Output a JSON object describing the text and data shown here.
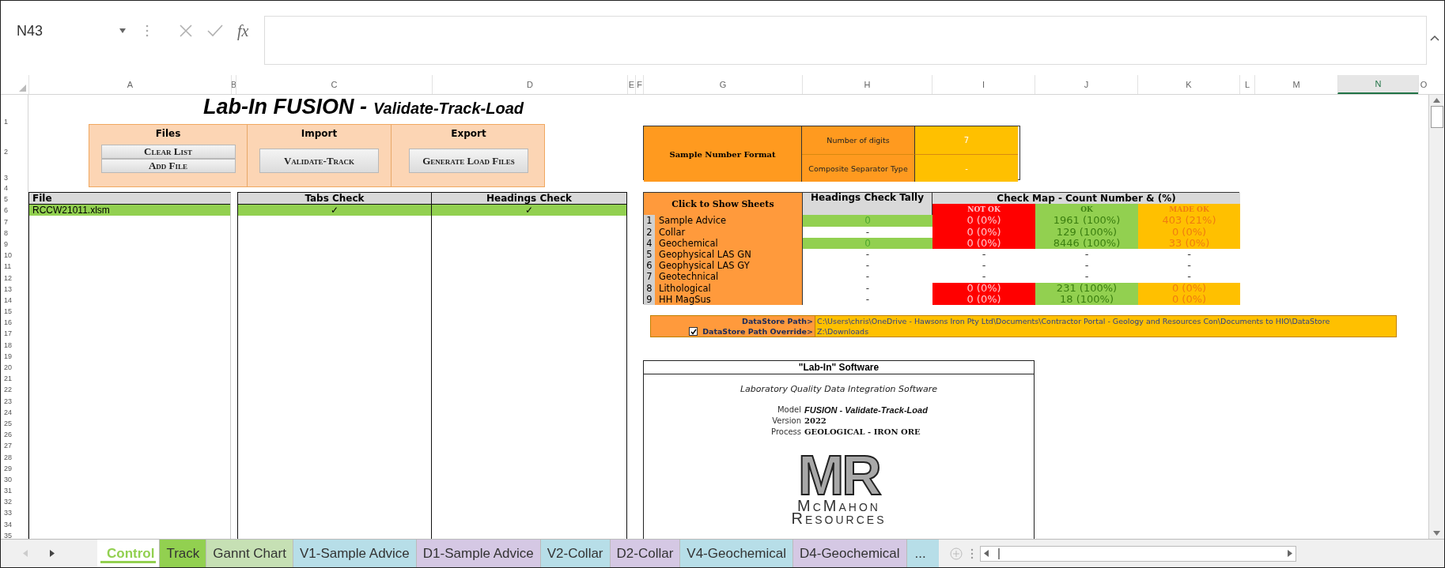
{
  "formula_bar": {
    "name_box": "N43",
    "function_label": "fx"
  },
  "column_headers": [
    {
      "label": "A",
      "selected": false
    },
    {
      "label": "B",
      "selected": false
    },
    {
      "label": "C",
      "selected": false
    },
    {
      "label": "D",
      "selected": false
    },
    {
      "label": "E",
      "selected": false
    },
    {
      "label": "F",
      "selected": false
    },
    {
      "label": "G",
      "selected": false
    },
    {
      "label": "H",
      "selected": false
    },
    {
      "label": "I",
      "selected": false
    },
    {
      "label": "J",
      "selected": false
    },
    {
      "label": "K",
      "selected": false
    },
    {
      "label": "L",
      "selected": false
    },
    {
      "label": "M",
      "selected": false
    },
    {
      "label": "N",
      "selected": true
    },
    {
      "label": "O",
      "selected": false
    }
  ],
  "row_numbers": [
    "1",
    "2",
    "3",
    "4",
    "5",
    "6",
    "7",
    "8",
    "9",
    "10",
    "11",
    "12",
    "13",
    "14",
    "15",
    "16",
    "17",
    "18",
    "19",
    "20",
    "21",
    "22",
    "23",
    "24",
    "25",
    "26",
    "27",
    "28",
    "29",
    "30",
    "31",
    "32",
    "33",
    "34",
    "35"
  ],
  "title": {
    "main": "Lab-In FUSION -",
    "sub": "Validate-Track-Load"
  },
  "actions": [
    {
      "heading": "Files",
      "buttons": [
        "Clear List",
        "Add File"
      ]
    },
    {
      "heading": "Import",
      "buttons": [
        "Validate-Track"
      ]
    },
    {
      "heading": "Export",
      "buttons": [
        "Generate Load Files"
      ]
    }
  ],
  "files_table": {
    "columns": [
      "File",
      "Tabs Check",
      "Headings Check"
    ],
    "rows": [
      {
        "file": "RCCW21011.xlsm",
        "tabs_check": "✓",
        "headings_check": "✓",
        "ok": true
      }
    ]
  },
  "sample_number_format": {
    "label": "Sample Number Format",
    "fields": [
      {
        "name": "Number of digits",
        "value": "7"
      },
      {
        "name": "Composite Separator Type",
        "value": "-"
      }
    ]
  },
  "check_map": {
    "sheets_heading": "Click to Show Sheets",
    "tally_heading": "Headings Check Tally",
    "map_heading": "Check Map - Count Number & (%)",
    "map_columns": [
      {
        "label": "NOT OK",
        "kind": "not_ok"
      },
      {
        "label": "OK",
        "kind": "ok"
      },
      {
        "label": "MADE OK",
        "kind": "made_ok"
      }
    ],
    "rows": [
      {
        "number": "1",
        "name": "Sample Advice",
        "tally": {
          "text": "0",
          "kind": "pass"
        },
        "cells": [
          {
            "text": "0 (0%)",
            "kind": "not_ok"
          },
          {
            "text": "1961 (100%)",
            "kind": "ok"
          },
          {
            "text": "403 (21%)",
            "kind": "made_ok"
          }
        ]
      },
      {
        "number": "2",
        "name": "Collar",
        "tally": {
          "text": "-",
          "kind": "empty"
        },
        "cells": [
          {
            "text": "0 (0%)",
            "kind": "not_ok"
          },
          {
            "text": "129 (100%)",
            "kind": "ok"
          },
          {
            "text": "0 (0%)",
            "kind": "made_ok"
          }
        ]
      },
      {
        "number": "4",
        "name": "Geochemical",
        "tally": {
          "text": "0",
          "kind": "pass"
        },
        "cells": [
          {
            "text": "0 (0%)",
            "kind": "not_ok"
          },
          {
            "text": "8446 (100%)",
            "kind": "ok"
          },
          {
            "text": "33 (0%)",
            "kind": "made_ok"
          }
        ]
      },
      {
        "number": "5",
        "name": "Geophysical LAS GN",
        "tally": {
          "text": "-",
          "kind": "empty"
        },
        "cells": [
          {
            "text": "-",
            "kind": "empty"
          },
          {
            "text": "-",
            "kind": "empty"
          },
          {
            "text": "-",
            "kind": "empty"
          }
        ]
      },
      {
        "number": "6",
        "name": "Geophysical LAS GY",
        "tally": {
          "text": "-",
          "kind": "empty"
        },
        "cells": [
          {
            "text": "-",
            "kind": "empty"
          },
          {
            "text": "-",
            "kind": "empty"
          },
          {
            "text": "-",
            "kind": "empty"
          }
        ]
      },
      {
        "number": "7",
        "name": "Geotechnical",
        "tally": {
          "text": "-",
          "kind": "empty"
        },
        "cells": [
          {
            "text": "-",
            "kind": "empty"
          },
          {
            "text": "-",
            "kind": "empty"
          },
          {
            "text": "-",
            "kind": "empty"
          }
        ]
      },
      {
        "number": "8",
        "name": "Lithological",
        "tally": {
          "text": "-",
          "kind": "empty"
        },
        "cells": [
          {
            "text": "0 (0%)",
            "kind": "not_ok"
          },
          {
            "text": "231 (100%)",
            "kind": "ok"
          },
          {
            "text": "0 (0%)",
            "kind": "made_ok"
          }
        ]
      },
      {
        "number": "9",
        "name": "HH MagSus",
        "tally": {
          "text": "-",
          "kind": "empty"
        },
        "cells": [
          {
            "text": "0 (0%)",
            "kind": "not_ok"
          },
          {
            "text": "18 (100%)",
            "kind": "ok"
          },
          {
            "text": "0 (0%)",
            "kind": "made_ok"
          }
        ]
      }
    ]
  },
  "datastore": [
    {
      "kind": "plain",
      "label": "DataStore Path>",
      "value": "C:\\Users\\chris\\OneDrive - Hawsons Iron Pty Ltd\\Documents\\Contractor Portal - Geology and Resources Con\\Documents to HIO\\DataStore"
    },
    {
      "kind": "checkbox",
      "checked": true,
      "label": "DataStore Path Override>",
      "value": "Z:\\Downloads"
    }
  ],
  "about": {
    "heading": "\"Lab-In\" Software",
    "tagline": "Laboratory Quality Data Integration Software",
    "details": [
      {
        "label": "Model",
        "value": "FUSION - Validate-Track-Load",
        "kind": "italic"
      },
      {
        "label": "Version",
        "value": "2022",
        "kind": "bold"
      },
      {
        "label": "Process",
        "value": "GEOLOGICAL - IRON ORE",
        "kind": "bold"
      }
    ],
    "logo": {
      "mark": "MR",
      "line_1": "McMahon",
      "line_2": "Resources"
    }
  },
  "sheet_tabs": [
    {
      "label": "Control",
      "selected": true,
      "color": "#92d050"
    },
    {
      "label": "Track",
      "selected": false,
      "color": "#92d050"
    },
    {
      "label": "Gannt Chart",
      "selected": false,
      "color": "#c6e0b4"
    },
    {
      "label": "V1-Sample Advice",
      "selected": false,
      "color": "#b7dee8"
    },
    {
      "label": "D1-Sample Advice",
      "selected": false,
      "color": "#d5c8e4"
    },
    {
      "label": "V2-Collar",
      "selected": false,
      "color": "#b7dee8"
    },
    {
      "label": "D2-Collar",
      "selected": false,
      "color": "#d5c8e4"
    },
    {
      "label": "V4-Geochemical",
      "selected": false,
      "color": "#b7dee8"
    },
    {
      "label": "D4-Geochemical",
      "selected": false,
      "color": "#d5c8e4"
    }
  ],
  "more_tabs": "..."
}
